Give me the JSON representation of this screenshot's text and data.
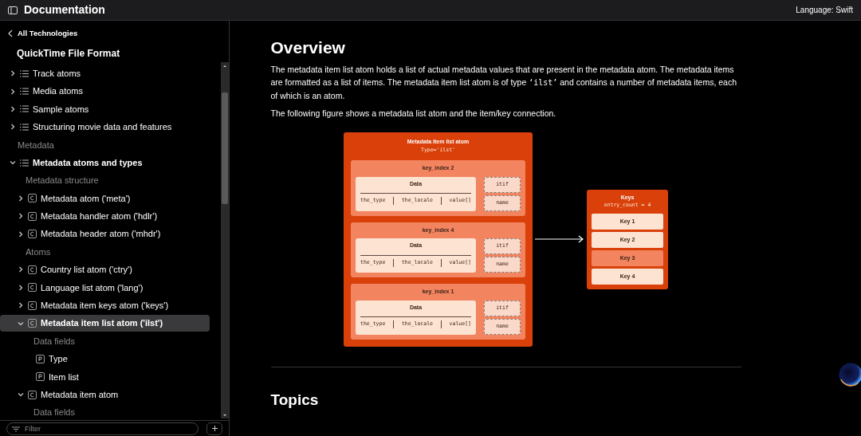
{
  "header": {
    "title": "Documentation",
    "language": "Language: Swift"
  },
  "nav": {
    "back": "All Technologies",
    "title": "QuickTime File Format",
    "items": [
      {
        "kind": "group",
        "label": "Track atoms",
        "expanded": false,
        "selected": false
      },
      {
        "kind": "group",
        "label": "Media atoms",
        "expanded": false,
        "selected": false
      },
      {
        "kind": "group",
        "label": "Sample atoms",
        "expanded": false,
        "selected": false
      },
      {
        "kind": "group",
        "label": "Structuring movie data and features",
        "expanded": false,
        "selected": false
      },
      {
        "kind": "section",
        "label": "Metadata"
      },
      {
        "kind": "group",
        "label": "Metadata atoms and types",
        "expanded": true,
        "selected": false,
        "children": [
          {
            "kind": "section",
            "label": "Metadata structure"
          },
          {
            "kind": "class",
            "label": "Metadata atom ('meta')",
            "expanded": false,
            "selected": false
          },
          {
            "kind": "class",
            "label": "Metadata handler atom ('hdlr')",
            "expanded": false,
            "selected": false
          },
          {
            "kind": "class",
            "label": "Metadata header atom ('mhdr')",
            "expanded": false,
            "selected": false
          },
          {
            "kind": "section",
            "label": "Atoms"
          },
          {
            "kind": "class",
            "label": "Country list atom ('ctry')",
            "expanded": false,
            "selected": false
          },
          {
            "kind": "class",
            "label": "Language list atom ('lang')",
            "expanded": false,
            "selected": false
          },
          {
            "kind": "class",
            "label": "Metadata item keys atom ('keys')",
            "expanded": false,
            "selected": false
          },
          {
            "kind": "class",
            "label": "Metadata item list atom ('ilst')",
            "expanded": true,
            "selected": true,
            "children": [
              {
                "kind": "section",
                "label": "Data fields"
              },
              {
                "kind": "property",
                "label": "Type",
                "selected": false
              },
              {
                "kind": "property",
                "label": "Item list",
                "selected": false
              }
            ]
          },
          {
            "kind": "class",
            "label": "Metadata item atom",
            "expanded": true,
            "selected": false,
            "children": [
              {
                "kind": "section",
                "label": "Data fields"
              }
            ]
          }
        ]
      }
    ],
    "filter": {
      "placeholder": "Filter"
    }
  },
  "content": {
    "heading": "Overview",
    "paragraphs": [
      {
        "before": "The metadata item list atom holds a list of actual metadata values that are present in the metadata atom. The metadata items are formatted as a list of items. The metadata item list atom is of type ",
        "code": "‘ilst’",
        "after": " and contains a number of metadata items, each of which is an atom."
      },
      {
        "before": "The following figure shows a metadata list atom and the item/key connection."
      }
    ],
    "figure": {
      "list_atom": {
        "title": "Metadata item list atom",
        "subtitle": "Type='ilst'",
        "entries": [
          {
            "label": "key_index 2",
            "data_title": "Data",
            "fields": [
              "the_type",
              "the_locale",
              "value[]"
            ],
            "tags": [
              "itif",
              "name"
            ]
          },
          {
            "label": "key_index 4",
            "data_title": "Data",
            "fields": [
              "the_type",
              "the_locale",
              "value[]"
            ],
            "tags": [
              "itif",
              "name"
            ]
          },
          {
            "label": "key_index 1",
            "data_title": "Data",
            "fields": [
              "the_type",
              "the_locale",
              "value[]"
            ],
            "tags": [
              "itif",
              "name"
            ]
          }
        ]
      },
      "keys_atom": {
        "title": "Keys",
        "subtitle": "entry_count = 4",
        "keys": [
          {
            "label": "Key 1",
            "highlighted": false
          },
          {
            "label": "Key 2",
            "highlighted": false
          },
          {
            "label": "Key 3",
            "highlighted": true
          },
          {
            "label": "Key 4",
            "highlighted": false
          }
        ]
      }
    },
    "topics_heading": "Topics"
  }
}
